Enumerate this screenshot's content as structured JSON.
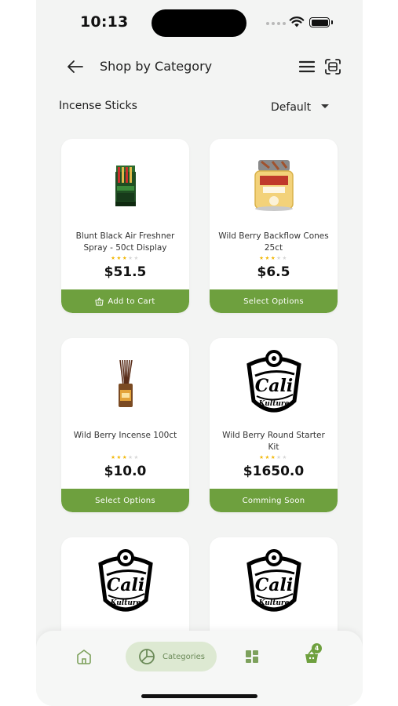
{
  "status_bar": {
    "time": "10:13"
  },
  "header": {
    "title": "Shop by Category"
  },
  "filter": {
    "category": "Incense Sticks",
    "sort": "Default"
  },
  "products": [
    {
      "name": "Blunt Black Air Freshner Spray - 50ct Display",
      "rating": 3,
      "price": "$51.5",
      "action": "Add to Cart",
      "image": "spray-display"
    },
    {
      "name": "Wild Berry Backflow Cones 25ct",
      "rating": 3,
      "price": "$6.5",
      "action": "Select Options",
      "image": "cones-jar"
    },
    {
      "name": "Wild Berry Incense 100ct",
      "rating": 3,
      "price": "$10.0",
      "action": "Select Options",
      "image": "incense-bundle"
    },
    {
      "name": "Wild Berry Round Starter Kit",
      "rating": 3,
      "price": "$1650.0",
      "action": "Comming Soon",
      "image": "cali-kulture-logo"
    },
    {
      "name": "",
      "rating": 0,
      "price": "",
      "action": "",
      "image": "cali-kulture-logo"
    },
    {
      "name": "",
      "rating": 0,
      "price": "",
      "action": "",
      "image": "cali-kulture-logo"
    }
  ],
  "logo_text": {
    "line1": "Cali",
    "line2": "Kulture"
  },
  "bottom_nav": {
    "categories_label": "Categories",
    "cart_count": "4"
  },
  "colors": {
    "accent": "#6ea03e",
    "active_pill": "#dde9d2",
    "star": "#f2b705"
  }
}
